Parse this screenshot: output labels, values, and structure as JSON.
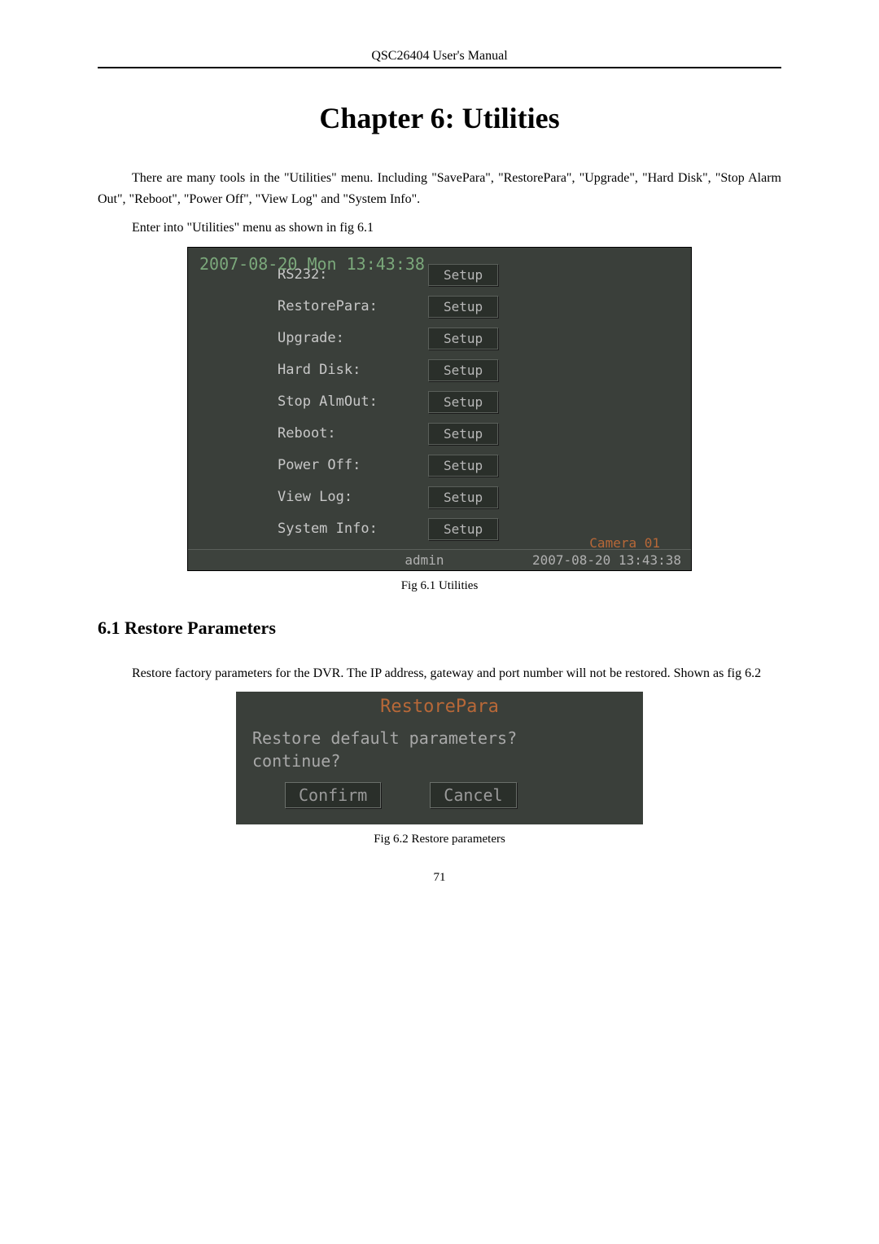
{
  "header": "QSC26404 User's Manual",
  "chapter_title": "Chapter 6: Utilities",
  "para1": "There are many tools in the \"Utilities\" menu. Including \"SavePara\", \"RestorePara\", \"Upgrade\", \"Hard Disk\", \"Stop Alarm Out\", \"Reboot\", \"Power Off\", \"View Log\" and \"System Info\".",
  "para2": "Enter into \"Utilities\" menu as shown in fig 6.1",
  "fig61": {
    "datetime": "2007-08-20 Mon 13:43:38",
    "rows": [
      {
        "label": "RS232:",
        "button": "Setup"
      },
      {
        "label": "RestorePara:",
        "button": "Setup"
      },
      {
        "label": "Upgrade:",
        "button": "Setup"
      },
      {
        "label": "Hard Disk:",
        "button": "Setup"
      },
      {
        "label": "Stop AlmOut:",
        "button": "Setup"
      },
      {
        "label": "Reboot:",
        "button": "Setup"
      },
      {
        "label": "Power Off:",
        "button": "Setup"
      },
      {
        "label": "View Log:",
        "button": "Setup"
      },
      {
        "label": "System Info:",
        "button": "Setup"
      }
    ],
    "status": {
      "camera": "Camera 01",
      "user": "admin",
      "timestamp": "2007-08-20 13:43:38"
    },
    "caption": "Fig 6.1 Utilities"
  },
  "section61": {
    "heading": "6.1    Restore Parameters",
    "para": "Restore factory parameters for the DVR. The IP address, gateway and port number will not be restored. Shown as fig 6.2"
  },
  "fig62": {
    "title": "RestorePara",
    "line1": "Restore default parameters?",
    "line2": "continue?",
    "confirm": "Confirm",
    "cancel": "Cancel",
    "caption": "Fig 6.2 Restore parameters"
  },
  "page_number": "71"
}
